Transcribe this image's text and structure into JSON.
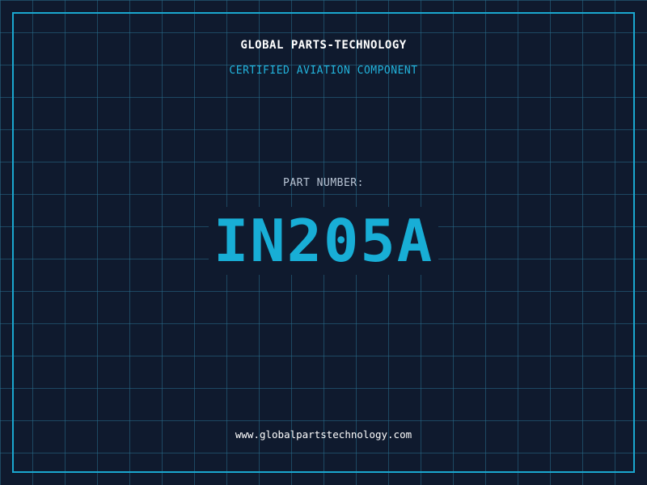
{
  "header": {
    "company": "GLOBAL PARTS-TECHNOLOGY",
    "subtitle": "CERTIFIED AVIATION COMPONENT"
  },
  "part": {
    "label": "PART NUMBER:",
    "number": "IN205A"
  },
  "footer": {
    "url": "www.globalpartstechnology.com"
  },
  "colors": {
    "background": "#0f1a2e",
    "grid": "#286e8c",
    "accent": "#1aa7cf",
    "text": "#ffffff",
    "label": "#b8c4d4"
  }
}
